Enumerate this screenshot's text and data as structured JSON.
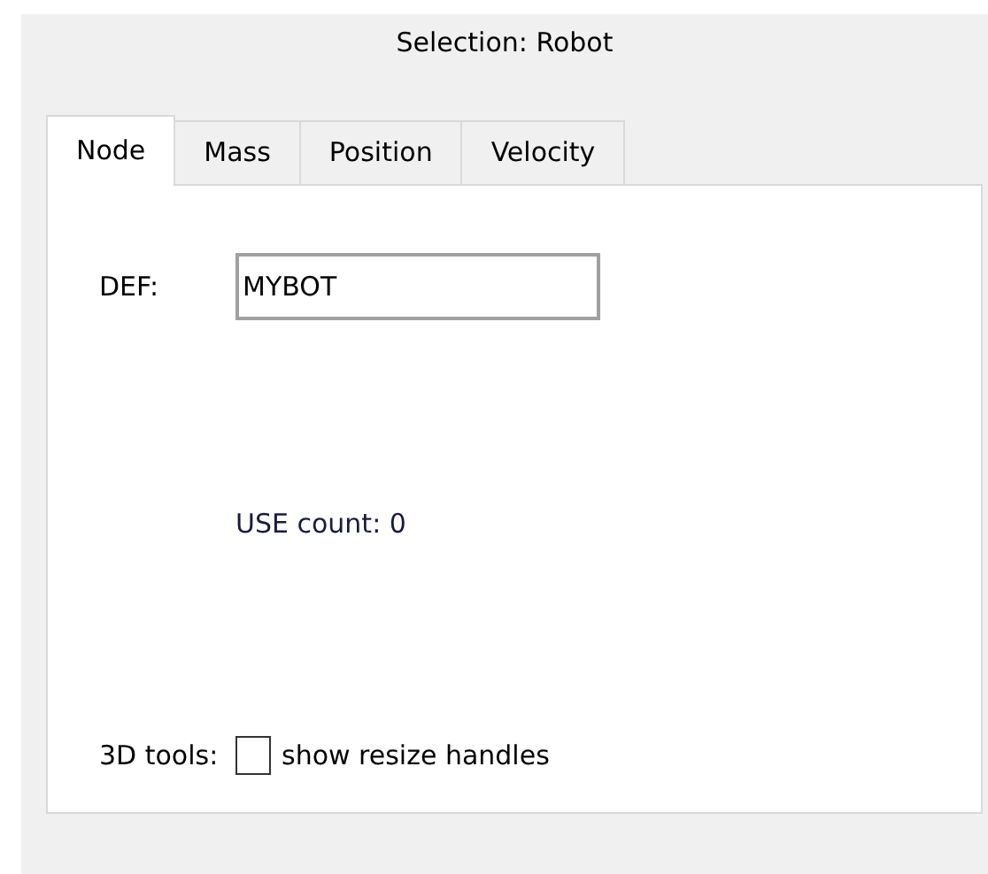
{
  "title": "Selection: Robot",
  "tabs": [
    {
      "label": "Node",
      "selected": true
    },
    {
      "label": "Mass",
      "selected": false
    },
    {
      "label": "Position",
      "selected": false
    },
    {
      "label": "Velocity",
      "selected": false
    }
  ],
  "def": {
    "label": "DEF:",
    "value": "MYBOT"
  },
  "use_count": "USE count: 0",
  "tools": {
    "label": "3D tools:",
    "checkbox": {
      "label": "show resize handles",
      "checked": false
    }
  }
}
